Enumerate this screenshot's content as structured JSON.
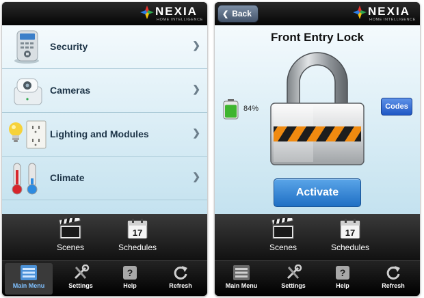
{
  "brand": {
    "name": "NEXIA",
    "tagline": "HOME INTELLIGENCE"
  },
  "main_menu": {
    "items": [
      {
        "label": "Security",
        "icon": "keypad-icon"
      },
      {
        "label": "Cameras",
        "icon": "camera-icon"
      },
      {
        "label": "Lighting and Modules",
        "icon": "lightbulb-outlet-icon"
      },
      {
        "label": "Climate",
        "icon": "thermometer-icon"
      }
    ]
  },
  "lock_screen": {
    "back_label": "Back",
    "title": "Front Entry Lock",
    "battery_pct": "84%",
    "battery_level": 0.84,
    "codes_label": "Codes",
    "activate_label": "Activate"
  },
  "shortcuts": {
    "scenes_label": "Scenes",
    "schedules_label": "Schedules",
    "calendar_day": "17"
  },
  "tabs": [
    {
      "label": "Main Menu",
      "icon": "main-menu-icon"
    },
    {
      "label": "Settings",
      "icon": "settings-icon"
    },
    {
      "label": "Help",
      "icon": "help-icon"
    },
    {
      "label": "Refresh",
      "icon": "refresh-icon"
    }
  ],
  "help_glyph": "?",
  "colors": {
    "accent_blue": "#1f6fc4",
    "active_tab_text": "#7fc0ff",
    "content_bg_top": "#f4fafd",
    "content_bg_bottom": "#c4e2ef"
  }
}
